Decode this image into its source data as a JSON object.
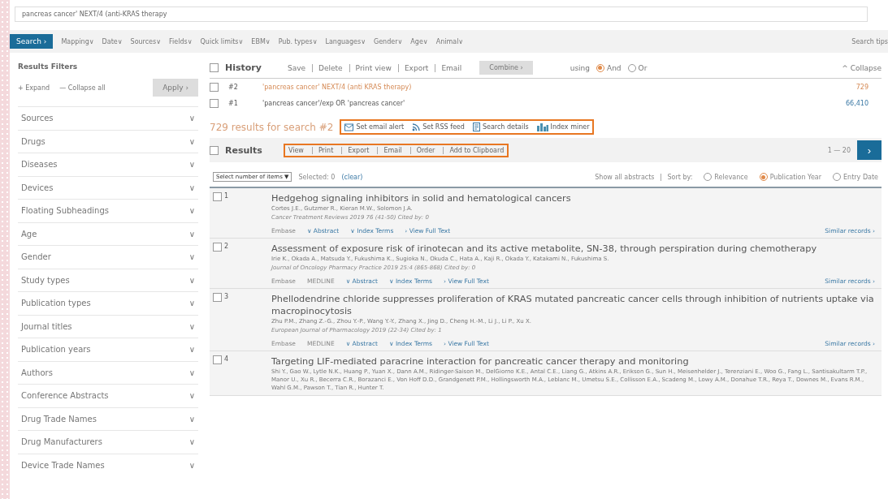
{
  "search_field": {
    "value": "pancreas cancer' NEXT/4 (anti-KRAS therapy"
  },
  "toolbar": {
    "search_button": "Search ›",
    "menus": [
      "Mapping∨",
      "Date∨",
      "Sources∨",
      "Fields∨",
      "Quick limits∨",
      "EBM∨",
      "Pub. types∨",
      "Languages∨",
      "Gender∨",
      "Age∨",
      "Animal∨"
    ],
    "tips": "Search tips"
  },
  "filters": {
    "title": "Results Filters",
    "expand": "+ Expand",
    "collapse": "— Collapse all",
    "apply": "Apply ›",
    "items": [
      "Sources",
      "Drugs",
      "Diseases",
      "Devices",
      "Floating Subheadings",
      "Age",
      "Gender",
      "Study types",
      "Publication types",
      "Journal titles",
      "Publication years",
      "Authors",
      "Conference Abstracts",
      "Drug Trade Names",
      "Drug Manufacturers",
      "Device Trade Names"
    ],
    "chevron": "∨"
  },
  "history": {
    "title": "History",
    "checked": false,
    "actions": [
      "Save",
      "Delete",
      "Print view",
      "Export",
      "Email"
    ],
    "combine": "Combine ›",
    "using": "using",
    "operators": [
      {
        "label": "And",
        "selected": true
      },
      {
        "label": "Or",
        "selected": false
      }
    ],
    "collapse": "^ Collapse",
    "rows": [
      {
        "number": "#2",
        "query": "'pancreas cancer' NEXT/4 (anti KRAS therapy)",
        "count": "729",
        "checked": false,
        "latest": true
      },
      {
        "number": "#1",
        "query": "'pancreas cancer'/exp OR 'pancreas cancer'",
        "count": "66,410",
        "checked": false,
        "latest": false
      }
    ]
  },
  "results_count": "729 results for search #2",
  "search_tools": [
    "Set email alert",
    "Set RSS feed",
    "Search details",
    "Index miner"
  ],
  "results": {
    "title": "Results",
    "checked": false,
    "actions": [
      "View",
      "Print",
      "Export",
      "Email",
      "Order",
      "Add to Clipboard"
    ],
    "range": "1 — 20",
    "next": "›",
    "select_items": "Select number of items ▼",
    "selected_label": "Selected: 0",
    "clear": "(clear)",
    "show_abstracts": "Show all abstracts",
    "sort_by": "Sort by:",
    "sort_options": [
      {
        "label": "Relevance",
        "selected": false
      },
      {
        "label": "Publication Year",
        "selected": true
      },
      {
        "label": "Entry Date",
        "selected": false
      }
    ],
    "items": [
      {
        "number": "1",
        "checked": false,
        "title": "Hedgehog signaling inhibitors in solid and hematological cancers",
        "authors": "Cortes J.E., Gutzmer R., Kieran M.W., Solomon J.A.",
        "source": "Cancer Treatment Reviews 2019 76 (41-50) Cited by: 0",
        "databases": [
          "Embase"
        ],
        "links": [
          "∨ Abstract",
          "∨ Index Terms",
          "› View Full Text"
        ],
        "similar": "Similar records ›"
      },
      {
        "number": "2",
        "checked": false,
        "title": "Assessment of exposure risk of irinotecan and its active metabolite, SN-38, through perspiration during chemotherapy",
        "authors": "Irie K., Okada A., Matsuda Y., Fukushima K., Sugioka N., Okuda C., Hata A., Kaji R., Okada Y., Katakami N., Fukushima S.",
        "source": "Journal of Oncology Pharmacy Practice 2019 25:4 (865-868) Cited by: 0",
        "databases": [
          "Embase",
          "MEDLINE"
        ],
        "links": [
          "∨ Abstract",
          "∨ Index Terms",
          "› View Full Text"
        ],
        "similar": "Similar records ›"
      },
      {
        "number": "3",
        "checked": false,
        "title": "Phellodendrine chloride suppresses proliferation of KRAS mutated pancreatic cancer cells through inhibition of nutrients uptake via macropinocytosis",
        "authors": "Zhu P.M., Zhang Z.-G., Zhou Y.-P., Wang Y.-Y., Zhang X., Jing D., Cheng H.-M., Li J., Li P., Xu X.",
        "source": "European Journal of Pharmacology 2019 (22-34) Cited by: 1",
        "databases": [
          "Embase",
          "MEDLINE"
        ],
        "links": [
          "∨ Abstract",
          "∨ Index Terms",
          "› View Full Text"
        ],
        "similar": "Similar records ›"
      },
      {
        "number": "4",
        "checked": false,
        "title": "Targeting LIF-mediated paracrine interaction for pancreatic cancer therapy and monitoring",
        "authors": "Shi Y., Gao W., Lytle N.K., Huang P., Yuan X., Dann A.M., Ridinger-Saison M., DelGiorno K.E., Antal C.E., Liang G., Atkins A.R., Erikson G., Sun H., Meisenhelder J., Terenziani E., Woo G., Fang L., Santisakultarm T.P., Manor U., Xu R., Becerra C.R., Borazanci E., Von Hoff D.D., Grandgenett P.M., Hollingsworth M.A., Leblanc M., Umetsu S.E., Collisson E.A., Scadeng M., Lowy A.M., Donahue T.R., Reya T., Downes M., Evans R.M., Wahl G.M., Pawson T., Tian R., Hunter T."
      }
    ]
  }
}
